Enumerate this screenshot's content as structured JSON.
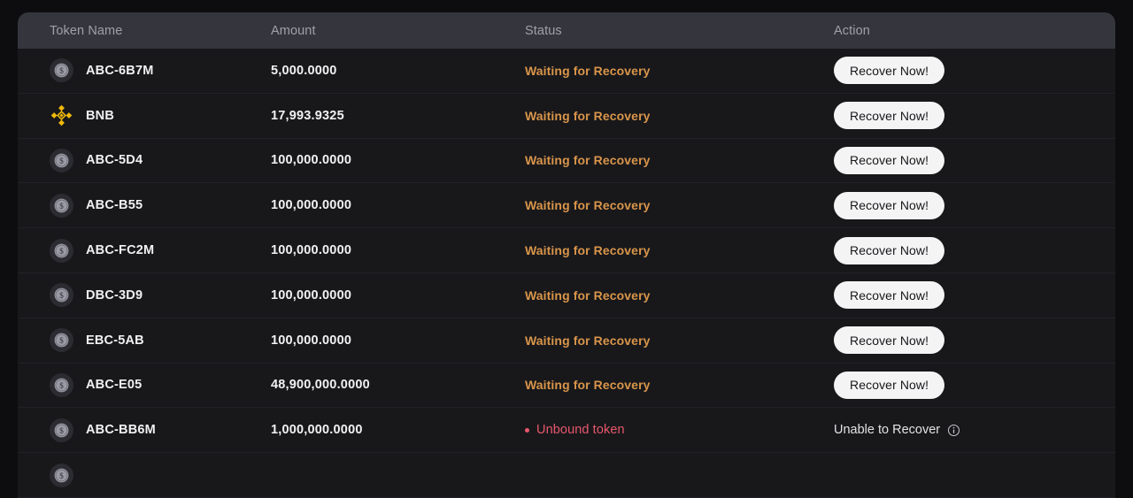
{
  "table": {
    "columns": [
      {
        "key": "token",
        "label": "Token Name"
      },
      {
        "key": "amount",
        "label": "Amount"
      },
      {
        "key": "status",
        "label": "Status"
      },
      {
        "key": "action",
        "label": "Action"
      }
    ],
    "rows": [
      {
        "icon": "coin-dollar-icon",
        "token": "ABC-6B7M",
        "amount": "5,000.0000",
        "status": "Waiting for Recovery",
        "status_type": "waiting",
        "action_label": "Recover Now!",
        "action_type": "button"
      },
      {
        "icon": "bnb-logo-icon",
        "token": "BNB",
        "amount": "17,993.9325",
        "status": "Waiting for Recovery",
        "status_type": "waiting",
        "action_label": "Recover Now!",
        "action_type": "button"
      },
      {
        "icon": "coin-dollar-icon",
        "token": "ABC-5D4",
        "amount": "100,000.0000",
        "status": "Waiting for Recovery",
        "status_type": "waiting",
        "action_label": "Recover Now!",
        "action_type": "button"
      },
      {
        "icon": "coin-dollar-icon",
        "token": "ABC-B55",
        "amount": "100,000.0000",
        "status": "Waiting for Recovery",
        "status_type": "waiting",
        "action_label": "Recover Now!",
        "action_type": "button"
      },
      {
        "icon": "coin-dollar-icon",
        "token": "ABC-FC2M",
        "amount": "100,000.0000",
        "status": "Waiting for Recovery",
        "status_type": "waiting",
        "action_label": "Recover Now!",
        "action_type": "button"
      },
      {
        "icon": "coin-dollar-icon",
        "token": "DBC-3D9",
        "amount": "100,000.0000",
        "status": "Waiting for Recovery",
        "status_type": "waiting",
        "action_label": "Recover Now!",
        "action_type": "button"
      },
      {
        "icon": "coin-dollar-icon",
        "token": "EBC-5AB",
        "amount": "100,000.0000",
        "status": "Waiting for Recovery",
        "status_type": "waiting",
        "action_label": "Recover Now!",
        "action_type": "button"
      },
      {
        "icon": "coin-dollar-icon",
        "token": "ABC-E05",
        "amount": "48,900,000.0000",
        "status": "Waiting for Recovery",
        "status_type": "waiting",
        "action_label": "Recover Now!",
        "action_type": "button"
      },
      {
        "icon": "coin-dollar-icon",
        "token": "ABC-BB6M",
        "amount": "1,000,000.0000",
        "status": "Unbound token",
        "status_type": "unbound",
        "action_label": "Unable to Recover",
        "action_type": "text",
        "action_icon": "info-circle-icon"
      },
      {
        "icon": "coin-dollar-icon",
        "token": "",
        "amount": "",
        "status": "",
        "status_type": "waiting",
        "action_label": "",
        "action_type": "none"
      }
    ]
  },
  "colors": {
    "page_background": "#0d0d10",
    "header_background": "#35363d",
    "row_background": "#18181b",
    "row_divider": "#222226",
    "status_waiting": "#d9954a",
    "status_unbound": "#e8576b",
    "button_background": "#f4f4f5",
    "button_text": "#17171a",
    "text_primary": "#f1f1f3",
    "text_header": "#a0a1a8",
    "bnb_gold": "#f0b90b"
  }
}
